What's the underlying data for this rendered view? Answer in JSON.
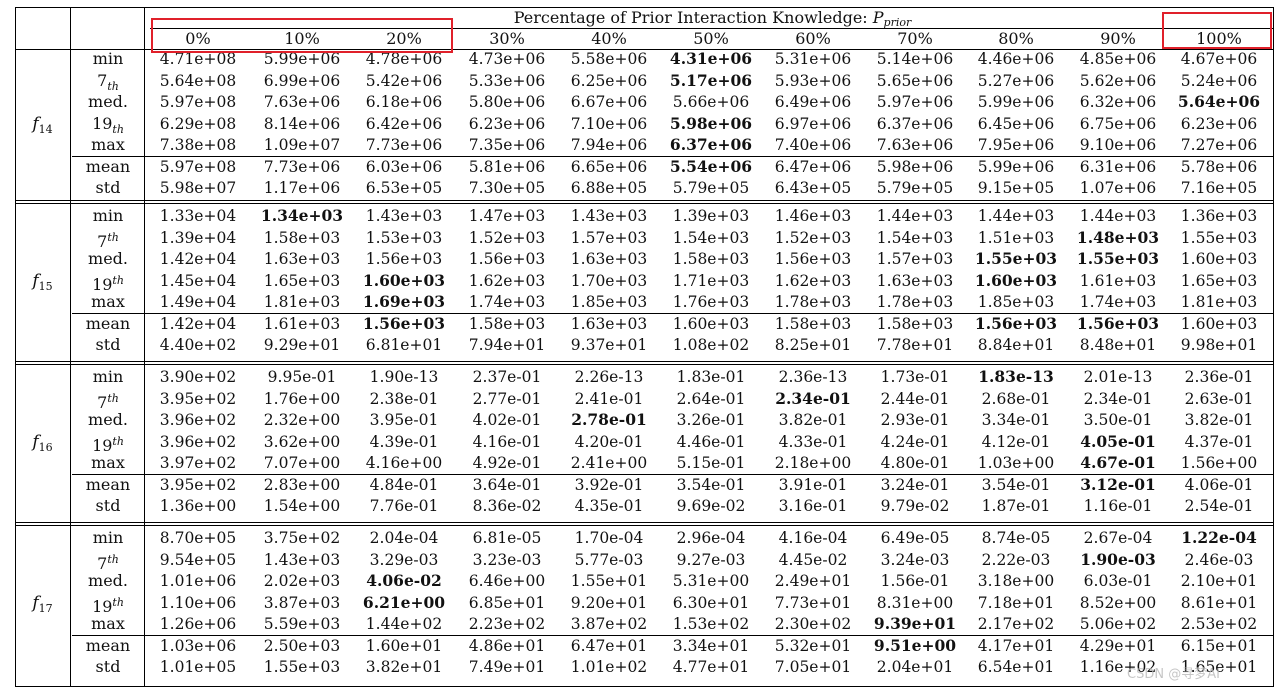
{
  "header": {
    "title_text": "Percentage of Prior Interaction Knowledge: ",
    "title_symbol": "P",
    "title_subscript": "prior",
    "percentages": [
      "0%",
      "10%",
      "20%",
      "30%",
      "40%",
      "50%",
      "60%",
      "70%",
      "80%",
      "90%",
      "100%"
    ]
  },
  "row_labels": [
    {
      "base": "min",
      "sup": "",
      "sub": ""
    },
    {
      "base": "7",
      "sup": "th",
      "sub": "",
      "subscript_style": true
    },
    {
      "base": "med.",
      "sup": "",
      "sub": ""
    },
    {
      "base": "19",
      "sup": "th",
      "sub": "",
      "subscript_style": true
    },
    {
      "base": "max",
      "sup": "",
      "sub": ""
    },
    {
      "base": "mean",
      "sup": "",
      "sub": ""
    },
    {
      "base": "std",
      "sup": "",
      "sub": ""
    }
  ],
  "groups": [
    {
      "fn_base": "f",
      "fn_sub": "14",
      "ordinal_mode": "sub",
      "rows": [
        {
          "label": "min",
          "values": [
            "4.71e+08",
            "5.99e+06",
            "4.78e+06",
            "4.73e+06",
            "5.58e+06",
            "4.31e+06",
            "5.31e+06",
            "5.14e+06",
            "4.46e+06",
            "4.85e+06",
            "4.67e+06"
          ],
          "bold": [
            5
          ]
        },
        {
          "label": "7th",
          "values": [
            "5.64e+08",
            "6.99e+06",
            "5.42e+06",
            "5.33e+06",
            "6.25e+06",
            "5.17e+06",
            "5.93e+06",
            "5.65e+06",
            "5.27e+06",
            "5.62e+06",
            "5.24e+06"
          ],
          "bold": [
            5
          ]
        },
        {
          "label": "med.",
          "values": [
            "5.97e+08",
            "7.63e+06",
            "6.18e+06",
            "5.80e+06",
            "6.67e+06",
            "5.66e+06",
            "6.49e+06",
            "5.97e+06",
            "5.99e+06",
            "6.32e+06",
            "5.64e+06"
          ],
          "bold": [
            10
          ]
        },
        {
          "label": "19th",
          "values": [
            "6.29e+08",
            "8.14e+06",
            "6.42e+06",
            "6.23e+06",
            "7.10e+06",
            "5.98e+06",
            "6.97e+06",
            "6.37e+06",
            "6.45e+06",
            "6.75e+06",
            "6.23e+06"
          ],
          "bold": [
            5
          ]
        },
        {
          "label": "max",
          "values": [
            "7.38e+08",
            "1.09e+07",
            "7.73e+06",
            "7.35e+06",
            "7.94e+06",
            "6.37e+06",
            "7.40e+06",
            "7.63e+06",
            "7.95e+06",
            "9.10e+06",
            "7.27e+06"
          ],
          "bold": [
            5
          ]
        },
        {
          "label": "mean",
          "values": [
            "5.97e+08",
            "7.73e+06",
            "6.03e+06",
            "5.81e+06",
            "6.65e+06",
            "5.54e+06",
            "6.47e+06",
            "5.98e+06",
            "5.99e+06",
            "6.31e+06",
            "5.78e+06"
          ],
          "bold": [
            5
          ]
        },
        {
          "label": "std",
          "values": [
            "5.98e+07",
            "1.17e+06",
            "6.53e+05",
            "7.30e+05",
            "6.88e+05",
            "5.79e+05",
            "6.43e+05",
            "5.79e+05",
            "9.15e+05",
            "1.07e+06",
            "7.16e+05"
          ],
          "bold": []
        }
      ]
    },
    {
      "fn_base": "f",
      "fn_sub": "15",
      "ordinal_mode": "sup",
      "rows": [
        {
          "label": "min",
          "values": [
            "1.33e+04",
            "1.34e+03",
            "1.43e+03",
            "1.47e+03",
            "1.43e+03",
            "1.39e+03",
            "1.46e+03",
            "1.44e+03",
            "1.44e+03",
            "1.44e+03",
            "1.36e+03"
          ],
          "bold": [
            1
          ]
        },
        {
          "label": "7th",
          "values": [
            "1.39e+04",
            "1.58e+03",
            "1.53e+03",
            "1.52e+03",
            "1.57e+03",
            "1.54e+03",
            "1.52e+03",
            "1.54e+03",
            "1.51e+03",
            "1.48e+03",
            "1.55e+03"
          ],
          "bold": [
            9
          ]
        },
        {
          "label": "med.",
          "values": [
            "1.42e+04",
            "1.63e+03",
            "1.56e+03",
            "1.56e+03",
            "1.63e+03",
            "1.58e+03",
            "1.56e+03",
            "1.57e+03",
            "1.55e+03",
            "1.55e+03",
            "1.60e+03"
          ],
          "bold": [
            8,
            9
          ]
        },
        {
          "label": "19th",
          "values": [
            "1.45e+04",
            "1.65e+03",
            "1.60e+03",
            "1.62e+03",
            "1.70e+03",
            "1.71e+03",
            "1.62e+03",
            "1.63e+03",
            "1.60e+03",
            "1.61e+03",
            "1.65e+03"
          ],
          "bold": [
            2,
            8
          ]
        },
        {
          "label": "max",
          "values": [
            "1.49e+04",
            "1.81e+03",
            "1.69e+03",
            "1.74e+03",
            "1.85e+03",
            "1.76e+03",
            "1.78e+03",
            "1.78e+03",
            "1.85e+03",
            "1.74e+03",
            "1.81e+03"
          ],
          "bold": [
            2
          ]
        },
        {
          "label": "mean",
          "values": [
            "1.42e+04",
            "1.61e+03",
            "1.56e+03",
            "1.58e+03",
            "1.63e+03",
            "1.60e+03",
            "1.58e+03",
            "1.58e+03",
            "1.56e+03",
            "1.56e+03",
            "1.60e+03"
          ],
          "bold": [
            2,
            8,
            9
          ]
        },
        {
          "label": "std",
          "values": [
            "4.40e+02",
            "9.29e+01",
            "6.81e+01",
            "7.94e+01",
            "9.37e+01",
            "1.08e+02",
            "8.25e+01",
            "7.78e+01",
            "8.84e+01",
            "8.48e+01",
            "9.98e+01"
          ],
          "bold": []
        }
      ]
    },
    {
      "fn_base": "f",
      "fn_sub": "16",
      "ordinal_mode": "sup",
      "rows": [
        {
          "label": "min",
          "values": [
            "3.90e+02",
            "9.95e-01",
            "1.90e-13",
            "2.37e-01",
            "2.26e-13",
            "1.83e-01",
            "2.36e-13",
            "1.73e-01",
            "1.83e-13",
            "2.01e-13",
            "2.36e-01"
          ],
          "bold": [
            8
          ]
        },
        {
          "label": "7th",
          "values": [
            "3.95e+02",
            "1.76e+00",
            "2.38e-01",
            "2.77e-01",
            "2.41e-01",
            "2.64e-01",
            "2.34e-01",
            "2.44e-01",
            "2.68e-01",
            "2.34e-01",
            "2.63e-01"
          ],
          "bold": [
            6
          ]
        },
        {
          "label": "med.",
          "values": [
            "3.96e+02",
            "2.32e+00",
            "3.95e-01",
            "4.02e-01",
            "2.78e-01",
            "3.26e-01",
            "3.82e-01",
            "2.93e-01",
            "3.34e-01",
            "3.50e-01",
            "3.82e-01"
          ],
          "bold": [
            4
          ]
        },
        {
          "label": "19th",
          "values": [
            "3.96e+02",
            "3.62e+00",
            "4.39e-01",
            "4.16e-01",
            "4.20e-01",
            "4.46e-01",
            "4.33e-01",
            "4.24e-01",
            "4.12e-01",
            "4.05e-01",
            "4.37e-01"
          ],
          "bold": [
            9
          ]
        },
        {
          "label": "max",
          "values": [
            "3.97e+02",
            "7.07e+00",
            "4.16e+00",
            "4.92e-01",
            "2.41e+00",
            "5.15e-01",
            "2.18e+00",
            "4.80e-01",
            "1.03e+00",
            "4.67e-01",
            "1.56e+00"
          ],
          "bold": [
            9
          ]
        },
        {
          "label": "mean",
          "values": [
            "3.95e+02",
            "2.83e+00",
            "4.84e-01",
            "3.64e-01",
            "3.92e-01",
            "3.54e-01",
            "3.91e-01",
            "3.24e-01",
            "3.54e-01",
            "3.12e-01",
            "4.06e-01"
          ],
          "bold": [
            9
          ]
        },
        {
          "label": "std",
          "values": [
            "1.36e+00",
            "1.54e+00",
            "7.76e-01",
            "8.36e-02",
            "4.35e-01",
            "9.69e-02",
            "3.16e-01",
            "9.79e-02",
            "1.87e-01",
            "1.16e-01",
            "2.54e-01"
          ],
          "bold": []
        }
      ]
    },
    {
      "fn_base": "f",
      "fn_sub": "17",
      "ordinal_mode": "sup",
      "rows": [
        {
          "label": "min",
          "values": [
            "8.70e+05",
            "3.75e+02",
            "2.04e-04",
            "6.81e-05",
            "1.70e-04",
            "2.96e-04",
            "4.16e-04",
            "6.49e-05",
            "8.74e-05",
            "2.67e-04",
            "1.22e-04"
          ],
          "bold": [
            10
          ]
        },
        {
          "label": "7th",
          "values": [
            "9.54e+05",
            "1.43e+03",
            "3.29e-03",
            "3.23e-03",
            "5.77e-03",
            "9.27e-03",
            "4.45e-02",
            "3.24e-03",
            "2.22e-03",
            "1.90e-03",
            "2.46e-03"
          ],
          "bold": [
            9
          ]
        },
        {
          "label": "med.",
          "values": [
            "1.01e+06",
            "2.02e+03",
            "4.06e-02",
            "6.46e+00",
            "1.55e+01",
            "5.31e+00",
            "2.49e+01",
            "1.56e-01",
            "3.18e+00",
            "6.03e-01",
            "2.10e+01"
          ],
          "bold": [
            2
          ]
        },
        {
          "label": "19th",
          "values": [
            "1.10e+06",
            "3.87e+03",
            "6.21e+00",
            "6.85e+01",
            "9.20e+01",
            "6.30e+01",
            "7.73e+01",
            "8.31e+00",
            "7.18e+01",
            "8.52e+00",
            "8.61e+01"
          ],
          "bold": [
            2
          ]
        },
        {
          "label": "max",
          "values": [
            "1.26e+06",
            "5.59e+03",
            "1.44e+02",
            "2.23e+02",
            "3.87e+02",
            "1.53e+02",
            "2.30e+02",
            "9.39e+01",
            "2.17e+02",
            "5.06e+02",
            "2.53e+02"
          ],
          "bold": [
            7
          ]
        },
        {
          "label": "mean",
          "values": [
            "1.03e+06",
            "2.50e+03",
            "1.60e+01",
            "4.86e+01",
            "6.47e+01",
            "3.34e+01",
            "5.32e+01",
            "9.51e+00",
            "4.17e+01",
            "4.29e+01",
            "6.15e+01"
          ],
          "bold": [
            7
          ]
        },
        {
          "label": "std",
          "values": [
            "1.01e+05",
            "1.55e+03",
            "3.82e+01",
            "7.49e+01",
            "1.01e+02",
            "4.77e+01",
            "7.05e+01",
            "2.04e+01",
            "6.54e+01",
            "1.16e+02",
            "1.65e+01"
          ],
          "bold": []
        }
      ]
    }
  ],
  "watermark": "CSDN @寻梦AI",
  "highlight_color": "#e0202a"
}
